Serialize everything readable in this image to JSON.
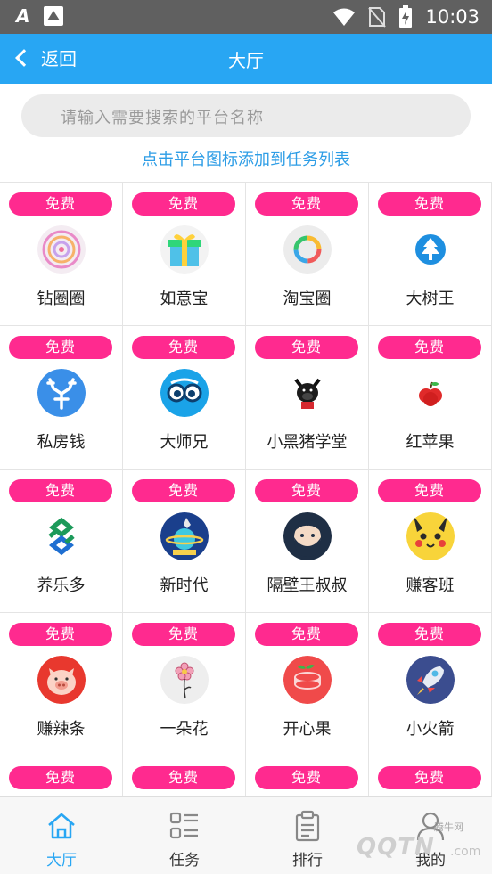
{
  "status_bar": {
    "time": "10:03"
  },
  "header": {
    "back_label": "返回",
    "title": "大厅"
  },
  "search": {
    "placeholder": "请输入需要搜索的平台名称"
  },
  "hint": "点击平台图标添加到任务列表",
  "badge_label": "免费",
  "apps": [
    {
      "name": "钻圈圈",
      "icon": "spiral-icon"
    },
    {
      "name": "如意宝",
      "icon": "gift-box-icon"
    },
    {
      "name": "淘宝圈",
      "icon": "color-ring-icon"
    },
    {
      "name": "大树王",
      "icon": "tree-icon"
    },
    {
      "name": "私房钱",
      "icon": "deer-icon"
    },
    {
      "name": "大师兄",
      "icon": "glasses-icon"
    },
    {
      "name": "小黑猪学堂",
      "icon": "black-pig-icon"
    },
    {
      "name": "红苹果",
      "icon": "apple-icon"
    },
    {
      "name": "养乐多",
      "icon": "knot-logo-icon"
    },
    {
      "name": "新时代",
      "icon": "planet-rocket-icon"
    },
    {
      "name": "隔壁王叔叔",
      "icon": "bearded-man-icon"
    },
    {
      "name": "赚客班",
      "icon": "pikachu-icon"
    },
    {
      "name": "赚辣条",
      "icon": "pig-face-icon"
    },
    {
      "name": "一朵花",
      "icon": "flower-icon"
    },
    {
      "name": "开心果",
      "icon": "macaron-icon"
    },
    {
      "name": "小火箭",
      "icon": "rocket-icon"
    },
    {
      "name": "",
      "icon": ""
    },
    {
      "name": "",
      "icon": ""
    },
    {
      "name": "",
      "icon": ""
    },
    {
      "name": "",
      "icon": ""
    }
  ],
  "bottom_nav": [
    {
      "label": "大厅",
      "icon": "home-icon",
      "active": true
    },
    {
      "label": "任务",
      "icon": "task-list-icon",
      "active": false
    },
    {
      "label": "排行",
      "icon": "clipboard-icon",
      "active": false
    },
    {
      "label": "我的",
      "icon": "user-icon",
      "active": false
    }
  ],
  "watermark": {
    "text": "QQTN",
    "small": "腾牛网",
    "suffix": ".com"
  },
  "colors": {
    "header": "#28a6f3",
    "badge": "#ff2a8f",
    "hint": "#2d9de6",
    "nav_active": "#28a6f3"
  }
}
